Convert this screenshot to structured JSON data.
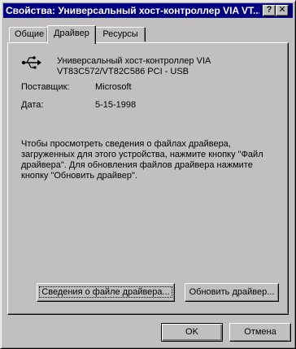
{
  "window": {
    "title": "Свойства: Универсальный хост-контроллер VIA VT...",
    "help_glyph": "?",
    "close_glyph": "✕"
  },
  "tabs": [
    {
      "label": "Общие",
      "active": false
    },
    {
      "label": "Драйвер",
      "active": true
    },
    {
      "label": "Ресурсы",
      "active": false
    }
  ],
  "device": {
    "icon": "usb-icon",
    "name_line1": "Универсальный хост-контроллер VIA",
    "name_line2": "VT83C572/VT82C586 PCI - USB"
  },
  "info": {
    "provider_label": "Поставщик:",
    "provider_value": "Microsoft",
    "date_label": "Дата:",
    "date_value": "5-15-1998"
  },
  "description": "Чтобы просмотреть сведения о файлах драйвера, загруженных для этого устройства, нажмите кнопку \"Файл драйвера\". Для обновления файлов драйвера нажмите кнопку \"Обновить драйвер\".",
  "buttons": {
    "driver_info": "Сведения о файле драйвера...",
    "update_driver": "Обновить драйвер...",
    "ok": "OK",
    "cancel": "Отмена"
  },
  "colors": {
    "titlebar": "#000080",
    "face": "#c0c0c0"
  }
}
